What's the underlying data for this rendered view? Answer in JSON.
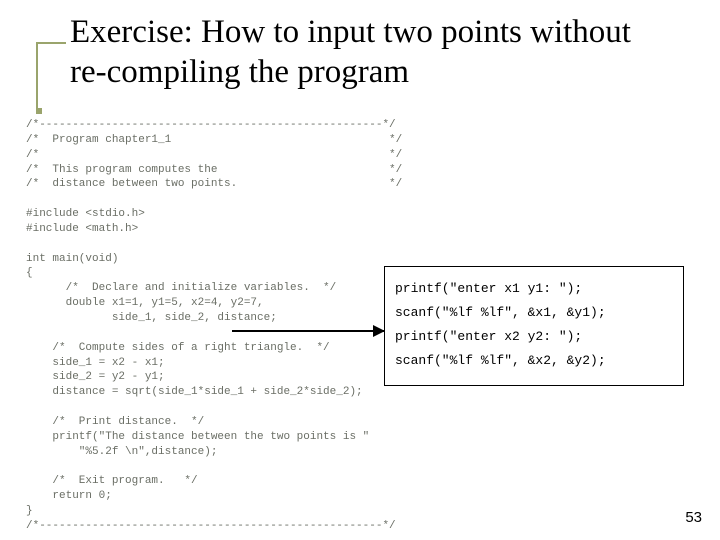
{
  "title": "Exercise: How to input two points without re-compiling the program",
  "code": {
    "l01": "/*----------------------------------------------------*/",
    "l02": "/*  Program chapter1_1                                 */",
    "l03": "/*                                                     */",
    "l04": "/*  This program computes the                          */",
    "l05": "/*  distance between two points.                       */",
    "l06": "",
    "l07": "#include <stdio.h>",
    "l08": "#include <math.h>",
    "l09": "",
    "l10": "int main(void)",
    "l11": "{",
    "l12": "      /*  Declare and initialize variables.  */",
    "l13": "      double x1=1, y1=5, x2=4, y2=7,",
    "l14": "             side_1, side_2, distance;",
    "l15": "",
    "l16": "    /*  Compute sides of a right triangle.  */",
    "l17": "    side_1 = x2 - x1;",
    "l18": "    side_2 = y2 - y1;",
    "l19": "    distance = sqrt(side_1*side_1 + side_2*side_2);",
    "l20": "",
    "l21": "    /*  Print distance.  */",
    "l22": "    printf(\"The distance between the two points is \"",
    "l23": "        \"%5.2f \\n\",distance);",
    "l24": "",
    "l25": "    /*  Exit program.   */",
    "l26": "    return 0;",
    "l27": "}",
    "l28": "/*----------------------------------------------------*/"
  },
  "callout": {
    "l1": "printf(\"enter x1 y1: \");",
    "l2": "scanf(\"%lf %lf\", &x1, &y1);",
    "l3": "printf(\"enter x2 y2: \");",
    "l4": "scanf(\"%lf %lf\", &x2, &y2);"
  },
  "page_number": "53"
}
